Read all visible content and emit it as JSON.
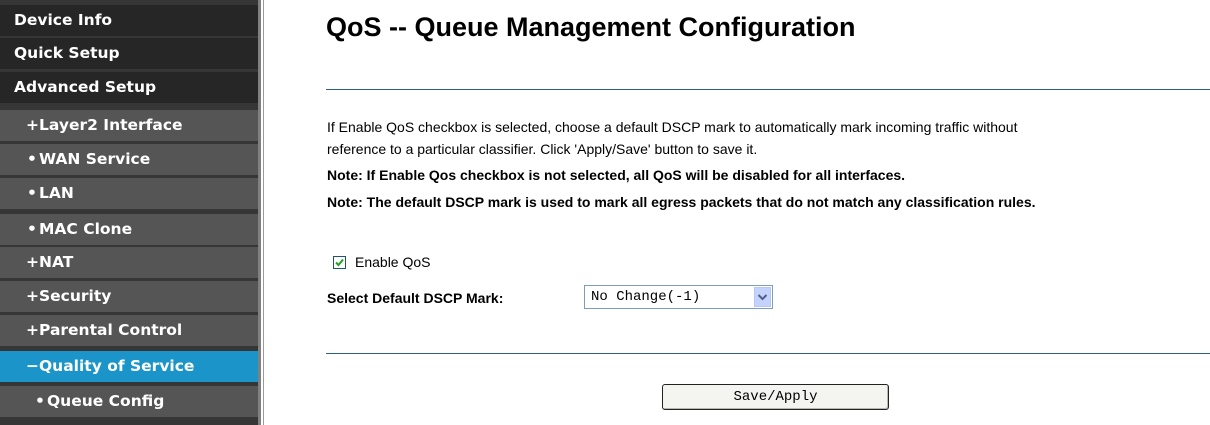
{
  "sidebar": {
    "items": [
      {
        "label": "Device Info",
        "bullet": ""
      },
      {
        "label": "Quick Setup",
        "bullet": ""
      },
      {
        "label": "Advanced Setup",
        "bullet": ""
      },
      {
        "label": "Layer2 Interface",
        "bullet": "+"
      },
      {
        "label": "WAN Service",
        "bullet": "•"
      },
      {
        "label": "LAN",
        "bullet": "•"
      },
      {
        "label": "MAC Clone",
        "bullet": "•"
      },
      {
        "label": "NAT",
        "bullet": "+"
      },
      {
        "label": "Security",
        "bullet": "+"
      },
      {
        "label": "Parental Control",
        "bullet": "+"
      },
      {
        "label": "Quality of Service",
        "bullet": "−"
      },
      {
        "label": "Queue Config",
        "bullet": "•"
      }
    ],
    "active_item": "Quality of Service"
  },
  "main": {
    "title": "QoS -- Queue Management Configuration",
    "description_line1": "If Enable QoS checkbox is selected, choose a default DSCP mark to automatically mark incoming traffic without",
    "description_line2": "reference to a particular classifier. Click 'Apply/Save' button to save it.",
    "note1": "Note: If Enable Qos checkbox is not selected, all QoS will be disabled for all interfaces.",
    "note2": "Note: The default DSCP mark is used to mark all egress packets that do not match any classification rules.",
    "enable_qos": {
      "label": "Enable QoS",
      "checked": true
    },
    "dscp": {
      "label": "Select Default DSCP Mark:",
      "value": "No Change(-1)"
    },
    "save_button": "Save/Apply"
  },
  "colors": {
    "sidebar_top": "#262626",
    "sidebar_sub": "#555555",
    "active": "#1b95c9",
    "rule": "#2c5f8a"
  },
  "icons": {
    "checkbox": "checkmark-icon",
    "dropdown": "chevron-down-icon"
  }
}
